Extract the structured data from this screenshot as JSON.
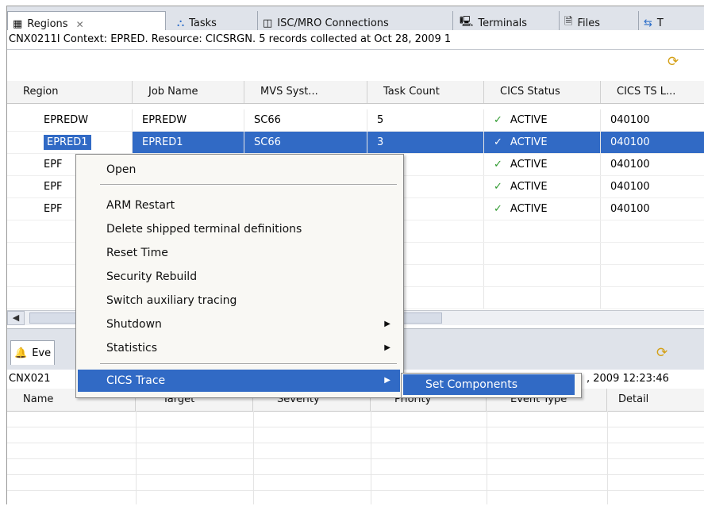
{
  "tabs": [
    {
      "label": "Regions",
      "icon": "regions-icon",
      "glyph": "▦",
      "active": true
    },
    {
      "label": "Tasks",
      "icon": "tasks-icon",
      "glyph": "⛬"
    },
    {
      "label": "ISC/MRO Connections",
      "icon": "connections-icon",
      "glyph": "◫"
    },
    {
      "label": "Terminals",
      "icon": "terminal-icon",
      "glyph": "🖳"
    },
    {
      "label": "Files",
      "icon": "files-icon",
      "glyph": "🗎"
    },
    {
      "label": "T",
      "icon": "transactions-icon",
      "glyph": "⇆"
    }
  ],
  "regions_status": "CNX0211I Context: EPRED. Resource: CICSRGN. 5 records collected at Oct 28, 2009 1",
  "regions_table": {
    "columns": [
      "Region",
      "Job Name",
      "MVS Syst...",
      "Task Count",
      "CICS Status",
      "CICS TS L..."
    ],
    "rows": [
      [
        "EPREDW",
        "EPREDW",
        "SC66",
        "5",
        "ACTIVE",
        "040100"
      ],
      [
        "EPRED1",
        "EPRED1",
        "SC66",
        "3",
        "ACTIVE",
        "040100"
      ],
      [
        "EPF",
        "",
        "",
        "",
        "ACTIVE",
        "040100"
      ],
      [
        "EPF",
        "",
        "",
        "",
        "ACTIVE",
        "040100"
      ],
      [
        "EPF",
        "",
        "",
        "",
        "ACTIVE",
        "040100"
      ]
    ]
  },
  "events_tab": {
    "label": "Eve",
    "icon": "bell-icon"
  },
  "events_status": "CNX021",
  "events_status_tail": ", 2009 12:23:46",
  "events_table": {
    "columns": [
      "Name",
      "Target",
      "Severity",
      "Priority",
      "Event Type",
      "Detail"
    ]
  },
  "context_menu": {
    "items": [
      {
        "label": "Open"
      },
      {
        "label": "ARM Restart"
      },
      {
        "label": "Delete shipped terminal definitions"
      },
      {
        "label": "Reset Time"
      },
      {
        "label": "Security Rebuild"
      },
      {
        "label": "Switch auxiliary tracing"
      },
      {
        "label": "Shutdown",
        "submenu": true
      },
      {
        "label": "Statistics",
        "submenu": true
      },
      {
        "label": "CICS Trace",
        "submenu": true,
        "highlighted": true
      }
    ],
    "submenu_items": [
      {
        "label": "Set Components",
        "highlighted": true
      }
    ]
  },
  "colors": {
    "selection": "#316ac5",
    "check": "#2f9a2f"
  }
}
